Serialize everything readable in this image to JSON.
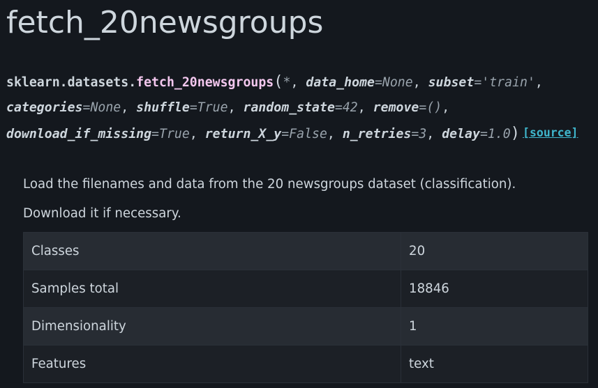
{
  "page": {
    "title": "fetch_20newsgroups"
  },
  "signature": {
    "prefix": "sklearn.datasets.",
    "name": "fetch_20newsgroups",
    "open_paren": "(",
    "close_paren": ")",
    "star": "*",
    "params": [
      {
        "name": "data_home",
        "default": "None"
      },
      {
        "name": "subset",
        "default": "'train'"
      },
      {
        "name": "categories",
        "default": "None"
      },
      {
        "name": "shuffle",
        "default": "True"
      },
      {
        "name": "random_state",
        "default": "42"
      },
      {
        "name": "remove",
        "default": "()"
      },
      {
        "name": "download_if_missing",
        "default": "True"
      },
      {
        "name": "return_X_y",
        "default": "False"
      },
      {
        "name": "n_retries",
        "default": "3"
      },
      {
        "name": "delay",
        "default": "1.0"
      }
    ],
    "source_link": "[source]"
  },
  "description": {
    "line1": "Load the filenames and data from the 20 newsgroups dataset (classification).",
    "line2": "Download it if necessary."
  },
  "table": {
    "rows": [
      {
        "key": "Classes",
        "value": "20"
      },
      {
        "key": "Samples total",
        "value": "18846"
      },
      {
        "key": "Dimensionality",
        "value": "1"
      },
      {
        "key": "Features",
        "value": "text"
      }
    ]
  },
  "colors": {
    "background": "#14181e",
    "text": "#ced6dd",
    "function_name": "#f3c7ee",
    "default_value": "#9aa4ad",
    "link": "#3fb6cc",
    "row_odd": "#272c33",
    "row_even": "#1c2026"
  }
}
